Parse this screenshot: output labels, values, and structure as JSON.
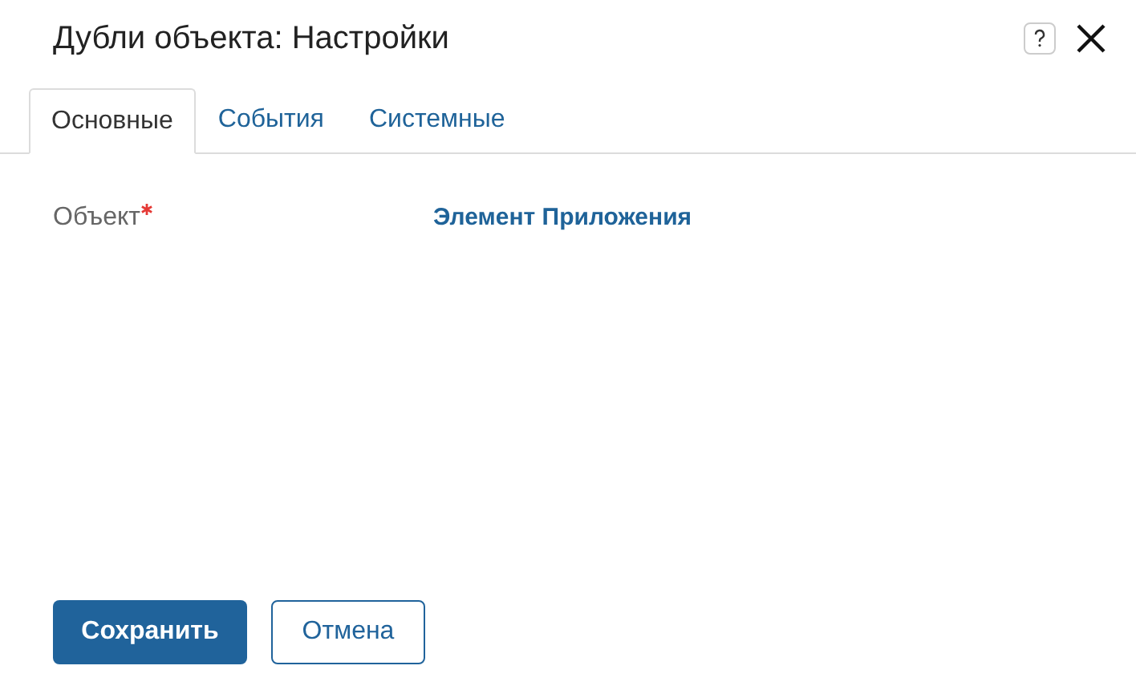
{
  "window": {
    "title": "Дубли объекта: Настройки"
  },
  "tabs": [
    {
      "label": "Основные",
      "selected": true
    },
    {
      "label": "События",
      "selected": false
    },
    {
      "label": "Системные",
      "selected": false
    }
  ],
  "fields": [
    {
      "label": "Объект",
      "required": true,
      "value": "Элемент Приложения"
    }
  ],
  "buttons": [
    {
      "label": "Сохранить",
      "kind": "primary"
    },
    {
      "label": "Отмена",
      "kind": "secondary"
    }
  ]
}
